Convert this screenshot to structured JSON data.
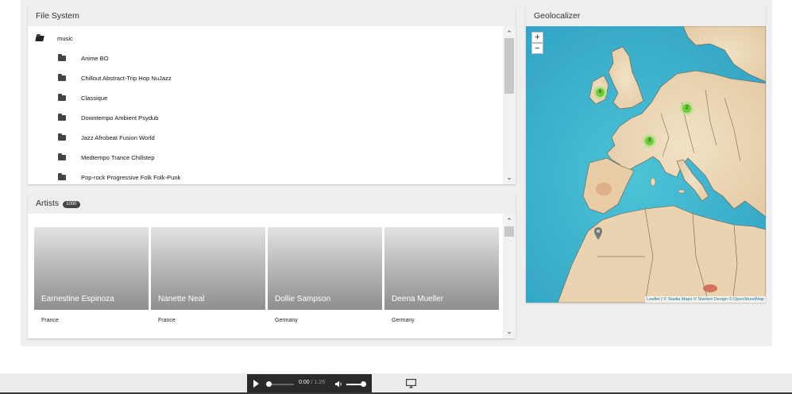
{
  "file_system": {
    "title": "File System",
    "root": "music",
    "folders": [
      "Anime BO",
      "Chillout Abstract-Trip Hop NuJazz",
      "Classique",
      "Downtempo Ambient Psydub",
      "Jazz Afrobeat Fusion World",
      "Medtempo Trance Chillstep",
      "Pop-rock Progressive Folk Folk-Punk"
    ]
  },
  "artists": {
    "title": "Artists",
    "count": "1000",
    "cards": [
      {
        "name": "Earnestine Espinoza",
        "country": "France"
      },
      {
        "name": "Nanette Neal",
        "country": "France"
      },
      {
        "name": "Dollie Sampson",
        "country": "Germany"
      },
      {
        "name": "Deena Mueller",
        "country": "Germany"
      }
    ]
  },
  "geolocalizer": {
    "title": "Geolocalizer",
    "zoom_in": "+",
    "zoom_out": "−",
    "clusters": [
      {
        "label": "8",
        "location": "Ireland"
      },
      {
        "label": "2",
        "location": "Germany"
      },
      {
        "label": "3",
        "location": "France"
      }
    ],
    "attribution": {
      "leaflet": "Leaflet",
      "stadia": "© Stadia Maps",
      "stamen": "© Stamen Design",
      "osm": "© OpenStreetMap"
    }
  },
  "player": {
    "current_time": "0:00",
    "separator": " / ",
    "duration": "1:26"
  },
  "icons": {
    "folder": "folder-icon",
    "folder_open": "folder-open-icon",
    "play": "play-icon",
    "volume": "volume-icon",
    "cast": "cast-icon",
    "map_marker": "map-marker-icon"
  },
  "colors": {
    "cluster_fill": "#6ecc39",
    "cluster_halo": "#b5e28c",
    "sea": "#35aecb",
    "land": "#ecd9b8",
    "player_bg": "#2a2a2a"
  }
}
